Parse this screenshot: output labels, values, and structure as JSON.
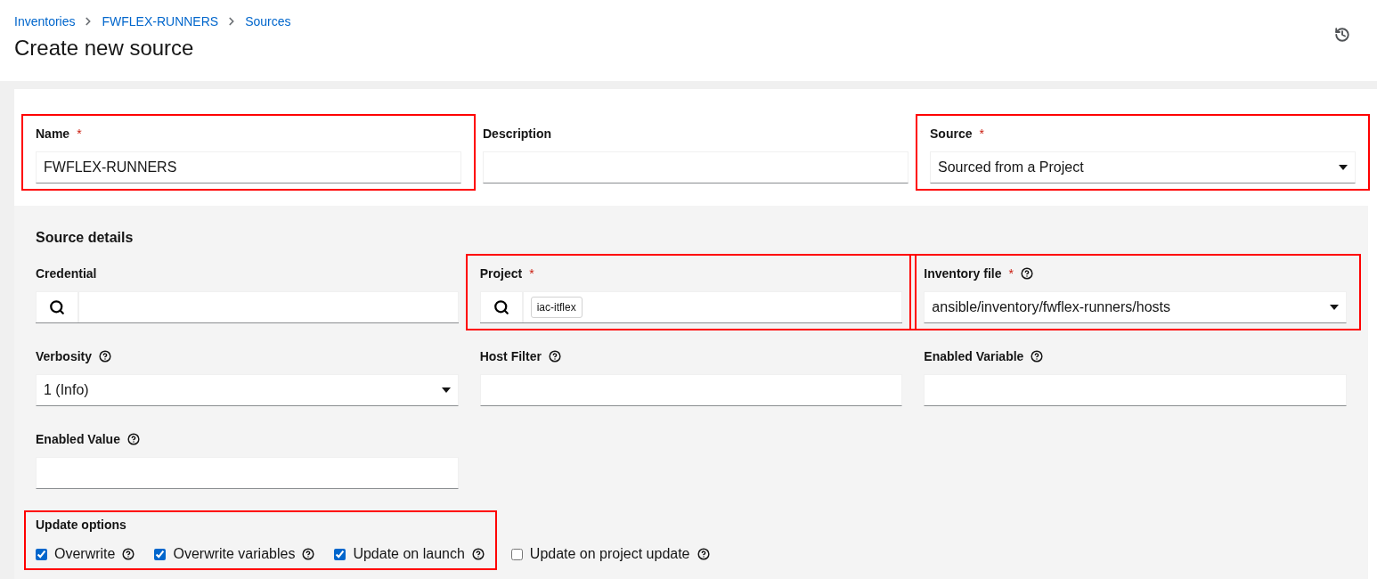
{
  "breadcrumbs": [
    "Inventories",
    "FWFLEX-RUNNERS",
    "Sources"
  ],
  "title": "Create new source",
  "top_fields": [
    {
      "kind": "text",
      "label": "Name",
      "required_mark": "*",
      "help": false,
      "value": "FWFLEX-RUNNERS",
      "highlighted": true
    },
    {
      "kind": "text",
      "label": "Description",
      "help": false,
      "highlighted": false
    },
    {
      "kind": "select",
      "label": "Source",
      "required_mark": "*",
      "help": false,
      "value": "Sourced from a Project",
      "highlighted": true
    }
  ],
  "details": {
    "heading": "Source details",
    "fields": [
      {
        "kind": "lookup",
        "label": "Credential",
        "help": false,
        "highlighted": false
      },
      {
        "kind": "lookup",
        "label": "Project",
        "required_mark": "*",
        "help": false,
        "chip": "iac-itflex",
        "highlighted": true
      },
      {
        "kind": "select",
        "label": "Inventory file",
        "required_mark": "*",
        "help": true,
        "value": "ansible/inventory/fwflex-runners/hosts",
        "highlighted": true
      },
      {
        "kind": "select",
        "label": "Verbosity",
        "help": true,
        "value": "1 (Info)",
        "highlighted": false
      },
      {
        "kind": "text",
        "label": "Host Filter",
        "help": true,
        "highlighted": false
      },
      {
        "kind": "text",
        "label": "Enabled Variable",
        "help": true,
        "highlighted": false
      },
      {
        "kind": "text",
        "label": "Enabled Value",
        "help": true,
        "highlighted": false
      }
    ],
    "update_options": {
      "label": "Update options",
      "highlighted": true,
      "options": [
        {
          "label": "Overwrite",
          "checked": true
        },
        {
          "label": "Overwrite variables",
          "checked": true
        },
        {
          "label": "Update on launch",
          "checked": true
        }
      ],
      "extra_options": [
        {
          "label": "Update on project update",
          "checked": false
        }
      ]
    }
  }
}
